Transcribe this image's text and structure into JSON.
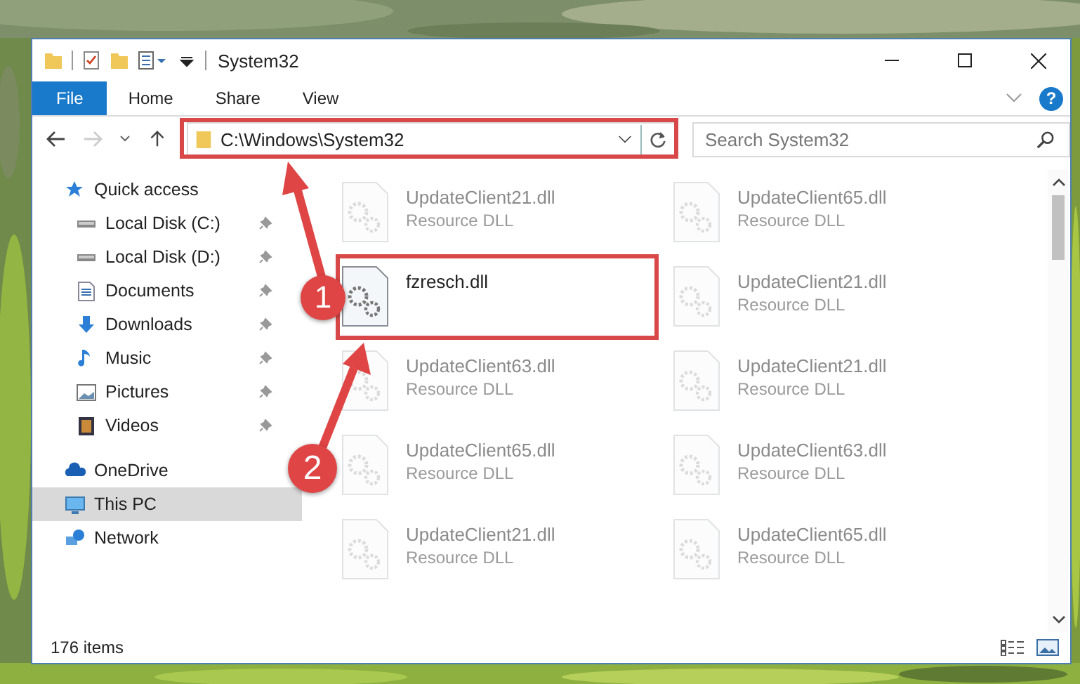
{
  "window": {
    "title": "System32"
  },
  "ribbon_tabs": [
    {
      "label": "File",
      "selected": true
    },
    {
      "label": "Home",
      "selected": false
    },
    {
      "label": "Share",
      "selected": false
    },
    {
      "label": "View",
      "selected": false
    }
  ],
  "help_button": {
    "label": "?"
  },
  "address_bar": {
    "path": "C:\\Windows\\System32"
  },
  "search": {
    "placeholder": "Search System32"
  },
  "sidebar": {
    "items": [
      {
        "label": "Quick access",
        "kind": "quick",
        "pinned": false,
        "selected": false,
        "children": [
          {
            "label": "Local Disk (C:)",
            "kind": "disk",
            "pinned": true,
            "selected": false
          },
          {
            "label": "Local Disk (D:)",
            "kind": "disk",
            "pinned": true,
            "selected": false
          },
          {
            "label": "Documents",
            "kind": "documents",
            "pinned": true,
            "selected": false
          },
          {
            "label": "Downloads",
            "kind": "downloads",
            "pinned": true,
            "selected": false
          },
          {
            "label": "Music",
            "kind": "music",
            "pinned": true,
            "selected": false
          },
          {
            "label": "Pictures",
            "kind": "pictures",
            "pinned": true,
            "selected": false
          },
          {
            "label": "Videos",
            "kind": "videos",
            "pinned": true,
            "selected": false
          }
        ]
      },
      {
        "label": "OneDrive",
        "kind": "cloud",
        "pinned": false,
        "selected": false
      },
      {
        "label": "This PC",
        "kind": "pc",
        "pinned": false,
        "selected": true
      },
      {
        "label": "Network",
        "kind": "network",
        "pinned": false,
        "selected": false
      }
    ]
  },
  "files": [
    {
      "name": "UpdateClient21.dll",
      "type": "Resource DLL",
      "dimmed": true
    },
    {
      "name": "UpdateClient65.dll",
      "type": "Resource DLL",
      "dimmed": true
    },
    {
      "name": "fzresch.dll",
      "dimmed": false
    },
    {
      "name": "UpdateClient21.dll",
      "type": "Resource DLL",
      "dimmed": true
    },
    {
      "name": "UpdateClient63.dll",
      "type": "Resource DLL",
      "dimmed": true
    },
    {
      "name": "UpdateClient21.dll",
      "type": "Resource DLL",
      "dimmed": true
    },
    {
      "name": "UpdateClient65.dll",
      "type": "Resource DLL",
      "dimmed": true
    },
    {
      "name": "UpdateClient63.dll",
      "type": "Resource DLL",
      "dimmed": true
    },
    {
      "name": "UpdateClient21.dll",
      "type": "Resource DLL",
      "dimmed": true
    },
    {
      "name": "UpdateClient65.dll",
      "type": "Resource DLL",
      "dimmed": true
    }
  ],
  "status_bar": {
    "item_count": "176 items"
  },
  "annotations": [
    {
      "number": "1"
    },
    {
      "number": "2"
    }
  ]
}
